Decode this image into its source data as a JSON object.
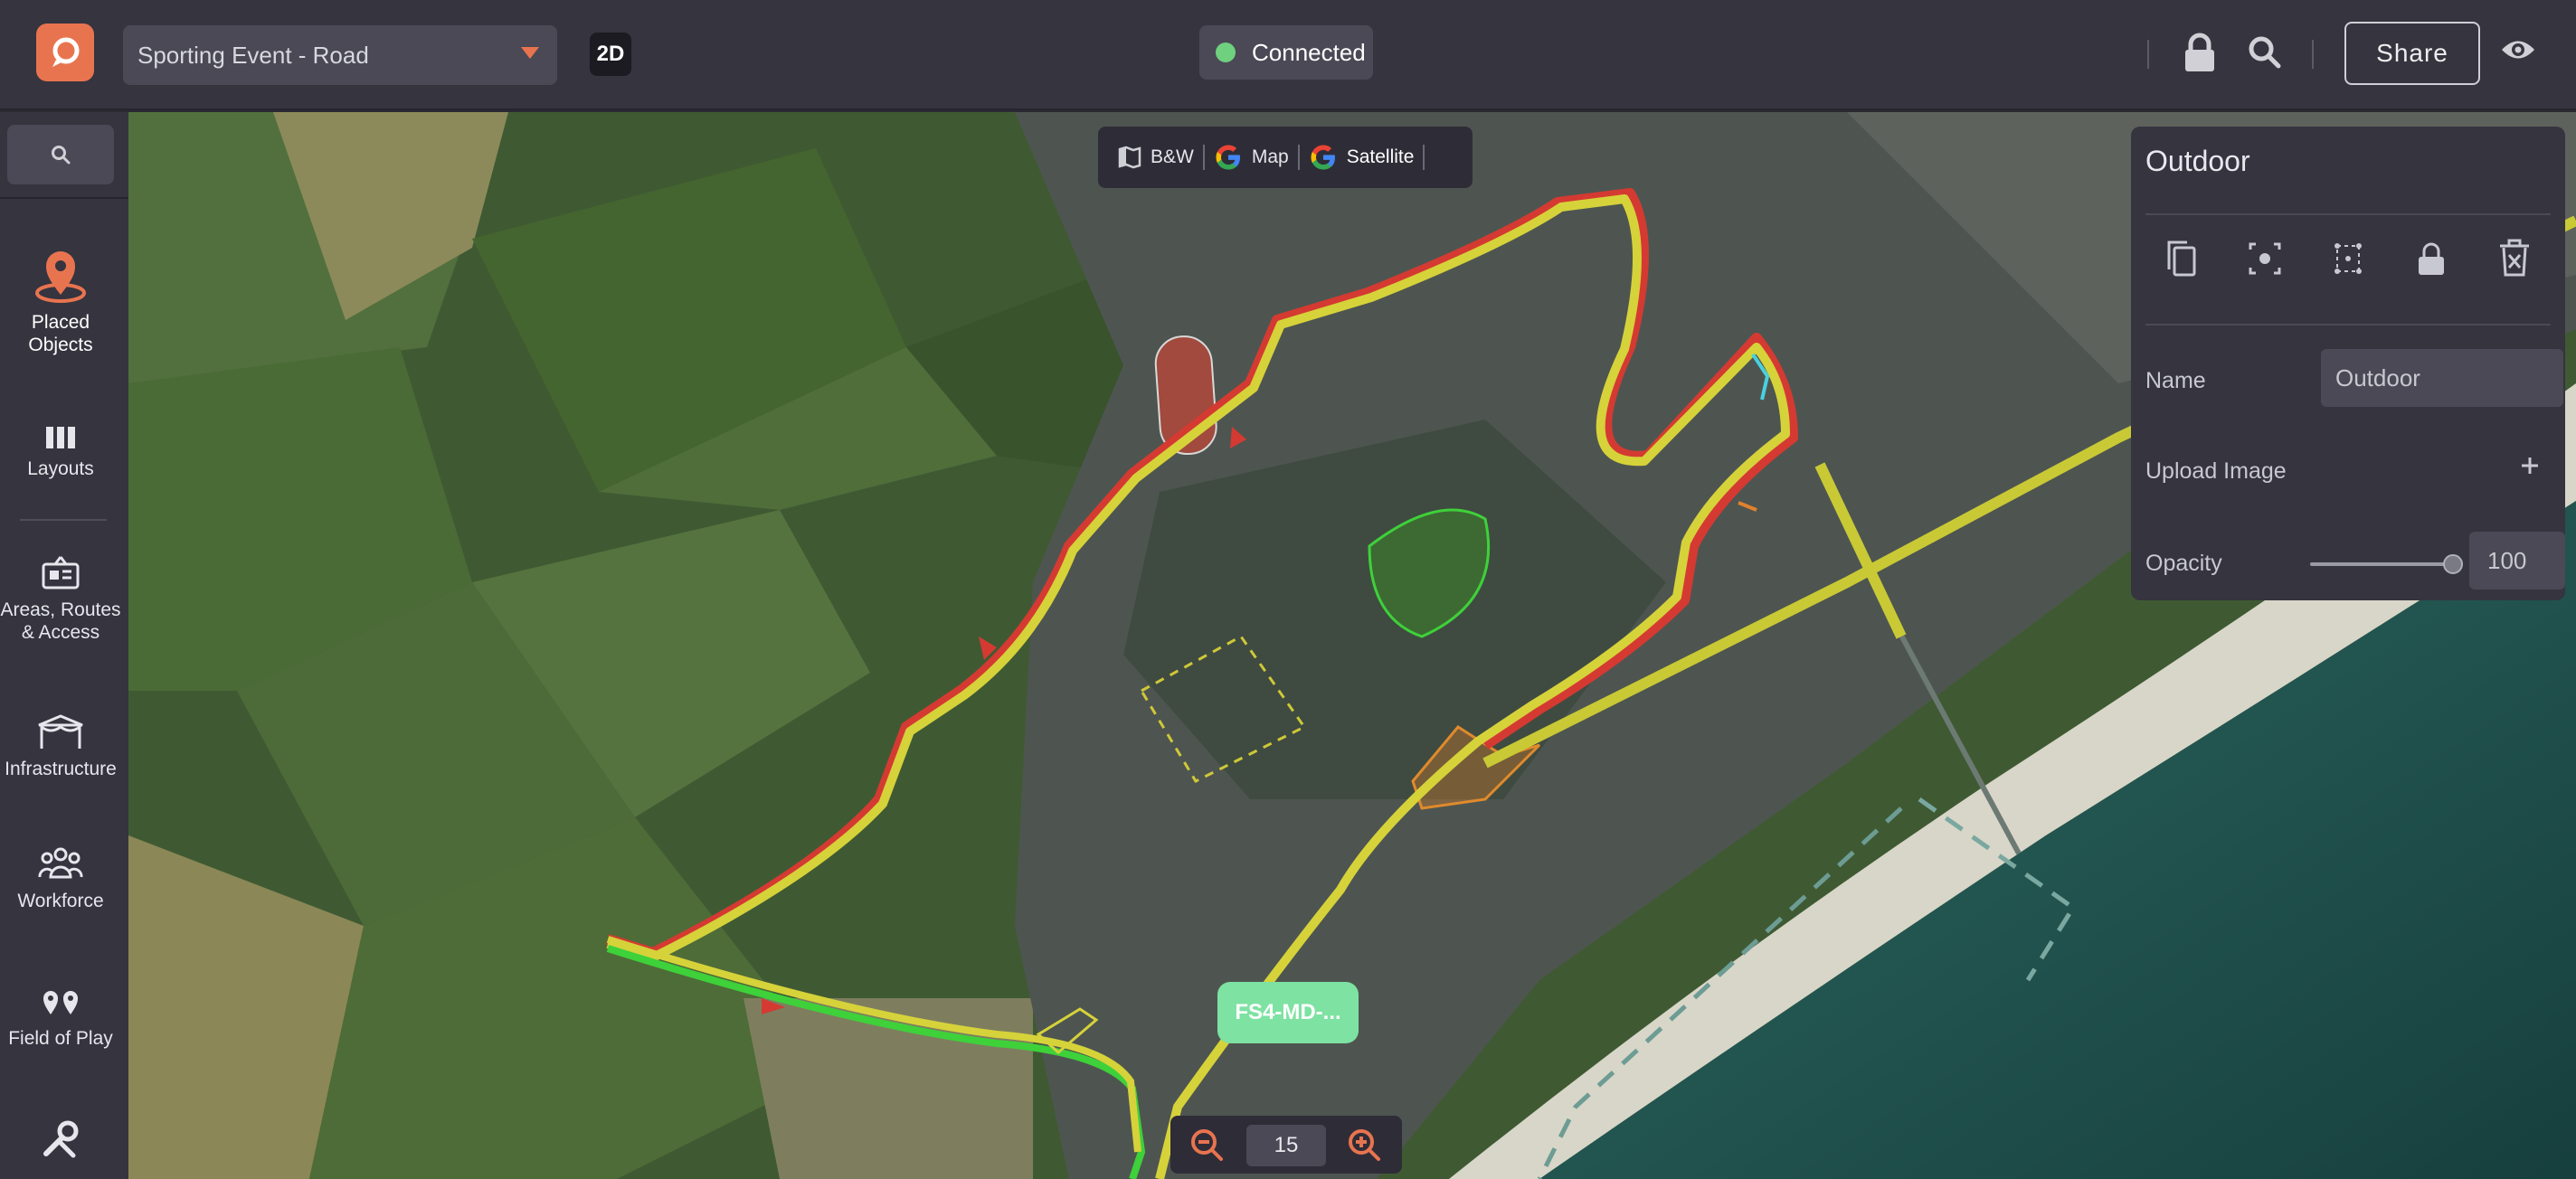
{
  "app": {
    "project_name": "Sporting Event - Road",
    "view_mode": "2D",
    "connection_status": "Connected",
    "share_label": "Share",
    "colors": {
      "accent": "#e8744f",
      "connected": "#6fd07f",
      "route_yellow": "#d6d23a",
      "route_red": "#d43a32",
      "route_green": "#3ed13a"
    }
  },
  "sidebar": {
    "items": [
      {
        "label": "Placed Objects",
        "icon": "map-pin-icon",
        "active": true
      },
      {
        "label": "Layouts",
        "icon": "columns-icon"
      },
      {
        "label": "Areas, Routes & Access",
        "icon": "route-sign-icon"
      },
      {
        "label": "Infrastructure",
        "icon": "tent-icon"
      },
      {
        "label": "Workforce",
        "icon": "people-icon"
      },
      {
        "label": "Field of Play",
        "icon": "two-pins-icon"
      },
      {
        "label": "",
        "icon": "tools-icon"
      }
    ]
  },
  "map_layers": {
    "bw": "B&W",
    "map": "Map",
    "satellite": "Satellite",
    "selected": "Satellite"
  },
  "panel": {
    "title": "Outdoor",
    "tools": [
      "copy-icon",
      "focus-icon",
      "points-icon",
      "lock-icon",
      "delete-icon"
    ],
    "name_label": "Name",
    "name_value": "Outdoor",
    "upload_label": "Upload Image",
    "opacity_label": "Opacity",
    "opacity_value": "100"
  },
  "map": {
    "marker_label": "FS4-MD-...",
    "zoom_level": "15"
  }
}
